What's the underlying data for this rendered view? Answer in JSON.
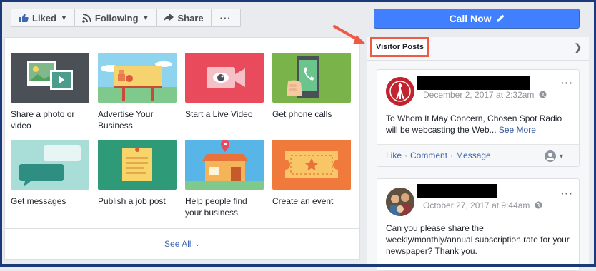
{
  "toolbar": {
    "liked_label": "Liked",
    "following_label": "Following",
    "share_label": "Share",
    "more_label": "···"
  },
  "call_now": {
    "label": "Call Now"
  },
  "actions_grid": {
    "see_all_label": "See All",
    "tiles": [
      {
        "label": "Share a photo or video"
      },
      {
        "label": "Advertise Your Business"
      },
      {
        "label": "Start a Live Video"
      },
      {
        "label": "Get phone calls"
      },
      {
        "label": "Get messages"
      },
      {
        "label": "Publish a job post"
      },
      {
        "label": "Help people find your business"
      },
      {
        "label": "Create an event"
      }
    ]
  },
  "visitor_posts": {
    "title": "Visitor Posts",
    "posts": [
      {
        "date": "December 2, 2017 at 2:32am",
        "text": "To Whom It May Concern, Chosen Spot Radio will be webcasting the Web... ",
        "see_more": "See More",
        "like": "Like",
        "comment": "Comment",
        "message": "Message"
      },
      {
        "date": "October 27, 2017 at 9:44am",
        "text": "Can you please share the weekly/monthly/annual subscription rate for your newspaper? Thank you."
      }
    ]
  },
  "colors": {
    "accent": "#4080ff",
    "link": "#4267b2",
    "highlight": "#ef5a46"
  }
}
